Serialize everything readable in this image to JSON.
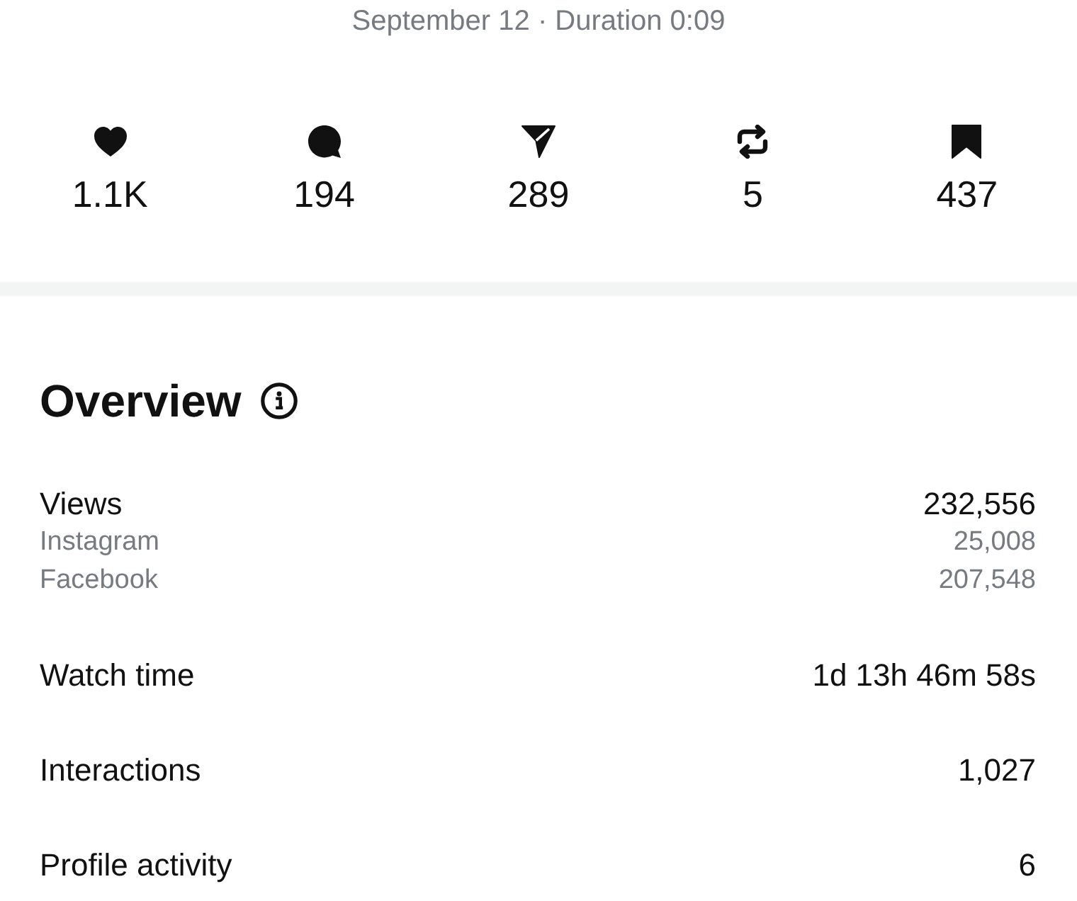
{
  "subtitle": "September 12 · Duration 0:09",
  "stats": [
    {
      "kind": "likes",
      "count": "1.1K"
    },
    {
      "kind": "comments",
      "count": "194"
    },
    {
      "kind": "shares",
      "count": "289"
    },
    {
      "kind": "reposts",
      "count": "5"
    },
    {
      "kind": "saves",
      "count": "437"
    }
  ],
  "overview": {
    "title": "Overview"
  },
  "metrics": [
    {
      "label": "Views",
      "value": "232,556",
      "breakdown": [
        {
          "label": "Instagram",
          "value": "25,008"
        },
        {
          "label": "Facebook",
          "value": "207,548"
        }
      ]
    },
    {
      "label": "Watch time",
      "value": "1d 13h 46m 58s"
    },
    {
      "label": "Interactions",
      "value": "1,027"
    },
    {
      "label": "Profile activity",
      "value": "6"
    }
  ]
}
